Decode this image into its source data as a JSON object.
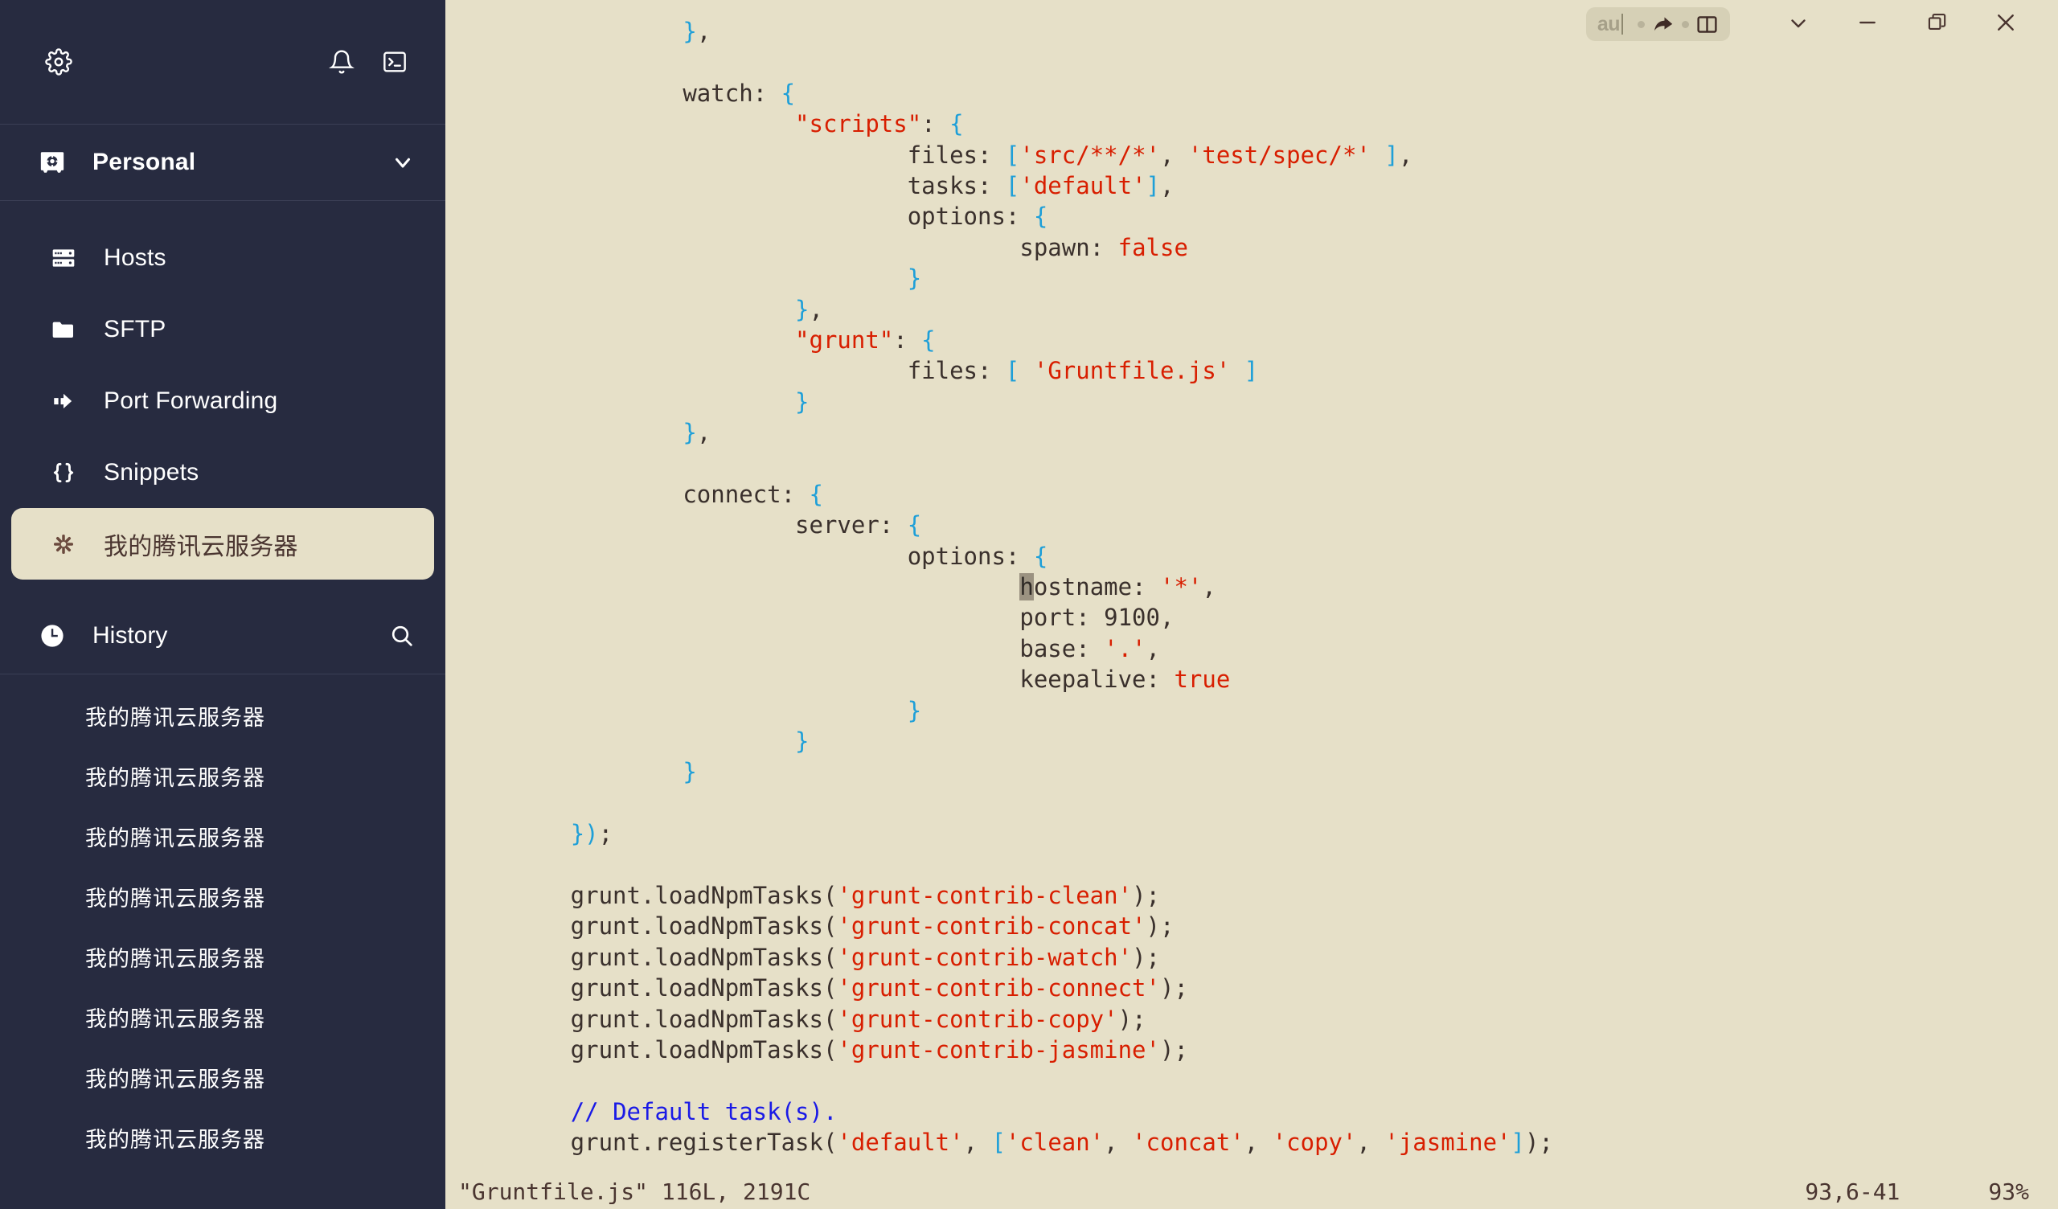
{
  "sidebar": {
    "top_actions": [
      {
        "name": "settings",
        "icon": "gear-icon"
      },
      {
        "name": "notifications",
        "icon": "bell-icon"
      },
      {
        "name": "terminal",
        "icon": "terminal-icon"
      }
    ],
    "vault": {
      "label": "Personal",
      "icon": "vault-icon",
      "chevron": "chevron-down-icon"
    },
    "nav_items": [
      {
        "label": "Hosts",
        "icon": "server-icon",
        "selected": false
      },
      {
        "label": "SFTP",
        "icon": "folder-icon",
        "selected": false
      },
      {
        "label": "Port Forwarding",
        "icon": "arrow-right-icon",
        "selected": false
      },
      {
        "label": "Snippets",
        "icon": "braces-icon",
        "selected": false
      },
      {
        "label": "我的腾讯云服务器",
        "icon": "asterisk-icon",
        "selected": true
      }
    ],
    "history": {
      "label": "History",
      "icon": "clock-icon",
      "search_icon": "search-icon",
      "items": [
        "我的腾讯云服务器",
        "我的腾讯云服务器",
        "我的腾讯云服务器",
        "我的腾讯云服务器",
        "我的腾讯云服务器",
        "我的腾讯云服务器",
        "我的腾讯云服务器",
        "我的腾讯云服务器"
      ]
    }
  },
  "window": {
    "tab_pill": {
      "text": "au",
      "share_icon": "share-arrow-icon",
      "split_icon": "split-pane-icon"
    },
    "controls": [
      {
        "name": "chevron-down-button",
        "icon": "chevron-down-icon"
      },
      {
        "name": "minimize-button",
        "icon": "minimize-icon"
      },
      {
        "name": "restore-button",
        "icon": "restore-icon"
      },
      {
        "name": "close-button",
        "icon": "close-icon"
      }
    ]
  },
  "terminal": {
    "colors": {
      "background": "#e6e0c8",
      "foreground": "#3a302c",
      "string": "#d81e00",
      "bracket": "#1e9fd8",
      "comment": "#1a1ae6",
      "cursor": "#9b9281",
      "sidebar_bg": "#272b40",
      "accent": "#e6e0c8"
    },
    "lines": [
      [
        {
          "t": "                ",
          "c": "plain"
        },
        {
          "t": "}",
          "c": "brk"
        },
        {
          "t": ",",
          "c": "plain"
        }
      ],
      [],
      [
        {
          "t": "                watch: ",
          "c": "plain"
        },
        {
          "t": "{",
          "c": "brk"
        }
      ],
      [
        {
          "t": "                        ",
          "c": "plain"
        },
        {
          "t": "\"scripts\"",
          "c": "str"
        },
        {
          "t": ": ",
          "c": "plain"
        },
        {
          "t": "{",
          "c": "brk"
        }
      ],
      [
        {
          "t": "                                files: ",
          "c": "plain"
        },
        {
          "t": "[",
          "c": "brk"
        },
        {
          "t": "'src/**/*'",
          "c": "str"
        },
        {
          "t": ", ",
          "c": "plain"
        },
        {
          "t": "'test/spec/*'",
          "c": "str"
        },
        {
          "t": " ",
          "c": "plain"
        },
        {
          "t": "]",
          "c": "brk"
        },
        {
          "t": ",",
          "c": "plain"
        }
      ],
      [
        {
          "t": "                                tasks: ",
          "c": "plain"
        },
        {
          "t": "[",
          "c": "brk"
        },
        {
          "t": "'default'",
          "c": "str"
        },
        {
          "t": "]",
          "c": "brk"
        },
        {
          "t": ",",
          "c": "plain"
        }
      ],
      [
        {
          "t": "                                options: ",
          "c": "plain"
        },
        {
          "t": "{",
          "c": "brk"
        }
      ],
      [
        {
          "t": "                                        spawn: ",
          "c": "plain"
        },
        {
          "t": "false",
          "c": "kw"
        }
      ],
      [
        {
          "t": "                                ",
          "c": "plain"
        },
        {
          "t": "}",
          "c": "brk"
        }
      ],
      [
        {
          "t": "                        ",
          "c": "plain"
        },
        {
          "t": "}",
          "c": "brk"
        },
        {
          "t": ",",
          "c": "plain"
        }
      ],
      [
        {
          "t": "                        ",
          "c": "plain"
        },
        {
          "t": "\"grunt\"",
          "c": "str"
        },
        {
          "t": ": ",
          "c": "plain"
        },
        {
          "t": "{",
          "c": "brk"
        }
      ],
      [
        {
          "t": "                                files: ",
          "c": "plain"
        },
        {
          "t": "[",
          "c": "brk"
        },
        {
          "t": " ",
          "c": "plain"
        },
        {
          "t": "'Gruntfile.js'",
          "c": "str"
        },
        {
          "t": " ",
          "c": "plain"
        },
        {
          "t": "]",
          "c": "brk"
        }
      ],
      [
        {
          "t": "                        ",
          "c": "plain"
        },
        {
          "t": "}",
          "c": "brk"
        }
      ],
      [
        {
          "t": "                ",
          "c": "plain"
        },
        {
          "t": "}",
          "c": "brk"
        },
        {
          "t": ",",
          "c": "plain"
        }
      ],
      [],
      [
        {
          "t": "                connect: ",
          "c": "plain"
        },
        {
          "t": "{",
          "c": "brk"
        }
      ],
      [
        {
          "t": "                        server: ",
          "c": "plain"
        },
        {
          "t": "{",
          "c": "brk"
        }
      ],
      [
        {
          "t": "                                options: ",
          "c": "plain"
        },
        {
          "t": "{",
          "c": "brk"
        }
      ],
      [
        {
          "t": "                                        ",
          "c": "plain"
        },
        {
          "t": "h",
          "c": "cursor"
        },
        {
          "t": "ostname: ",
          "c": "plain"
        },
        {
          "t": "'*'",
          "c": "str"
        },
        {
          "t": ",",
          "c": "plain"
        }
      ],
      [
        {
          "t": "                                        port: 9100,",
          "c": "plain"
        }
      ],
      [
        {
          "t": "                                        base: ",
          "c": "plain"
        },
        {
          "t": "'.'",
          "c": "str"
        },
        {
          "t": ",",
          "c": "plain"
        }
      ],
      [
        {
          "t": "                                        keepalive: ",
          "c": "plain"
        },
        {
          "t": "true",
          "c": "kw"
        }
      ],
      [
        {
          "t": "                                ",
          "c": "plain"
        },
        {
          "t": "}",
          "c": "brk"
        }
      ],
      [
        {
          "t": "                        ",
          "c": "plain"
        },
        {
          "t": "}",
          "c": "brk"
        }
      ],
      [
        {
          "t": "                ",
          "c": "plain"
        },
        {
          "t": "}",
          "c": "brk"
        }
      ],
      [],
      [
        {
          "t": "        ",
          "c": "plain"
        },
        {
          "t": "}",
          "c": "brk"
        },
        {
          "t": ")",
          "c": "brk"
        },
        {
          "t": ";",
          "c": "plain"
        }
      ],
      [],
      [
        {
          "t": "        grunt.loadNpmTasks(",
          "c": "plain"
        },
        {
          "t": "'grunt-contrib-clean'",
          "c": "str"
        },
        {
          "t": ");",
          "c": "plain"
        }
      ],
      [
        {
          "t": "        grunt.loadNpmTasks(",
          "c": "plain"
        },
        {
          "t": "'grunt-contrib-concat'",
          "c": "str"
        },
        {
          "t": ");",
          "c": "plain"
        }
      ],
      [
        {
          "t": "        grunt.loadNpmTasks(",
          "c": "plain"
        },
        {
          "t": "'grunt-contrib-watch'",
          "c": "str"
        },
        {
          "t": ");",
          "c": "plain"
        }
      ],
      [
        {
          "t": "        grunt.loadNpmTasks(",
          "c": "plain"
        },
        {
          "t": "'grunt-contrib-connect'",
          "c": "str"
        },
        {
          "t": ");",
          "c": "plain"
        }
      ],
      [
        {
          "t": "        grunt.loadNpmTasks(",
          "c": "plain"
        },
        {
          "t": "'grunt-contrib-copy'",
          "c": "str"
        },
        {
          "t": ");",
          "c": "plain"
        }
      ],
      [
        {
          "t": "        grunt.loadNpmTasks(",
          "c": "plain"
        },
        {
          "t": "'grunt-contrib-jasmine'",
          "c": "str"
        },
        {
          "t": ");",
          "c": "plain"
        }
      ],
      [],
      [
        {
          "t": "        ",
          "c": "plain"
        },
        {
          "t": "// Default task(s).",
          "c": "cmt"
        }
      ],
      [
        {
          "t": "        grunt.registerTask(",
          "c": "plain"
        },
        {
          "t": "'default'",
          "c": "str"
        },
        {
          "t": ", ",
          "c": "plain"
        },
        {
          "t": "[",
          "c": "brk"
        },
        {
          "t": "'clean'",
          "c": "str"
        },
        {
          "t": ", ",
          "c": "plain"
        },
        {
          "t": "'concat'",
          "c": "str"
        },
        {
          "t": ", ",
          "c": "plain"
        },
        {
          "t": "'copy'",
          "c": "str"
        },
        {
          "t": ", ",
          "c": "plain"
        },
        {
          "t": "'jasmine'",
          "c": "str"
        },
        {
          "t": "]",
          "c": "brk"
        },
        {
          "t": ");",
          "c": "plain"
        }
      ]
    ],
    "status": {
      "file": "\"Gruntfile.js\" 116L, 2191C",
      "position": "93,6-41",
      "percent": "93%"
    }
  }
}
